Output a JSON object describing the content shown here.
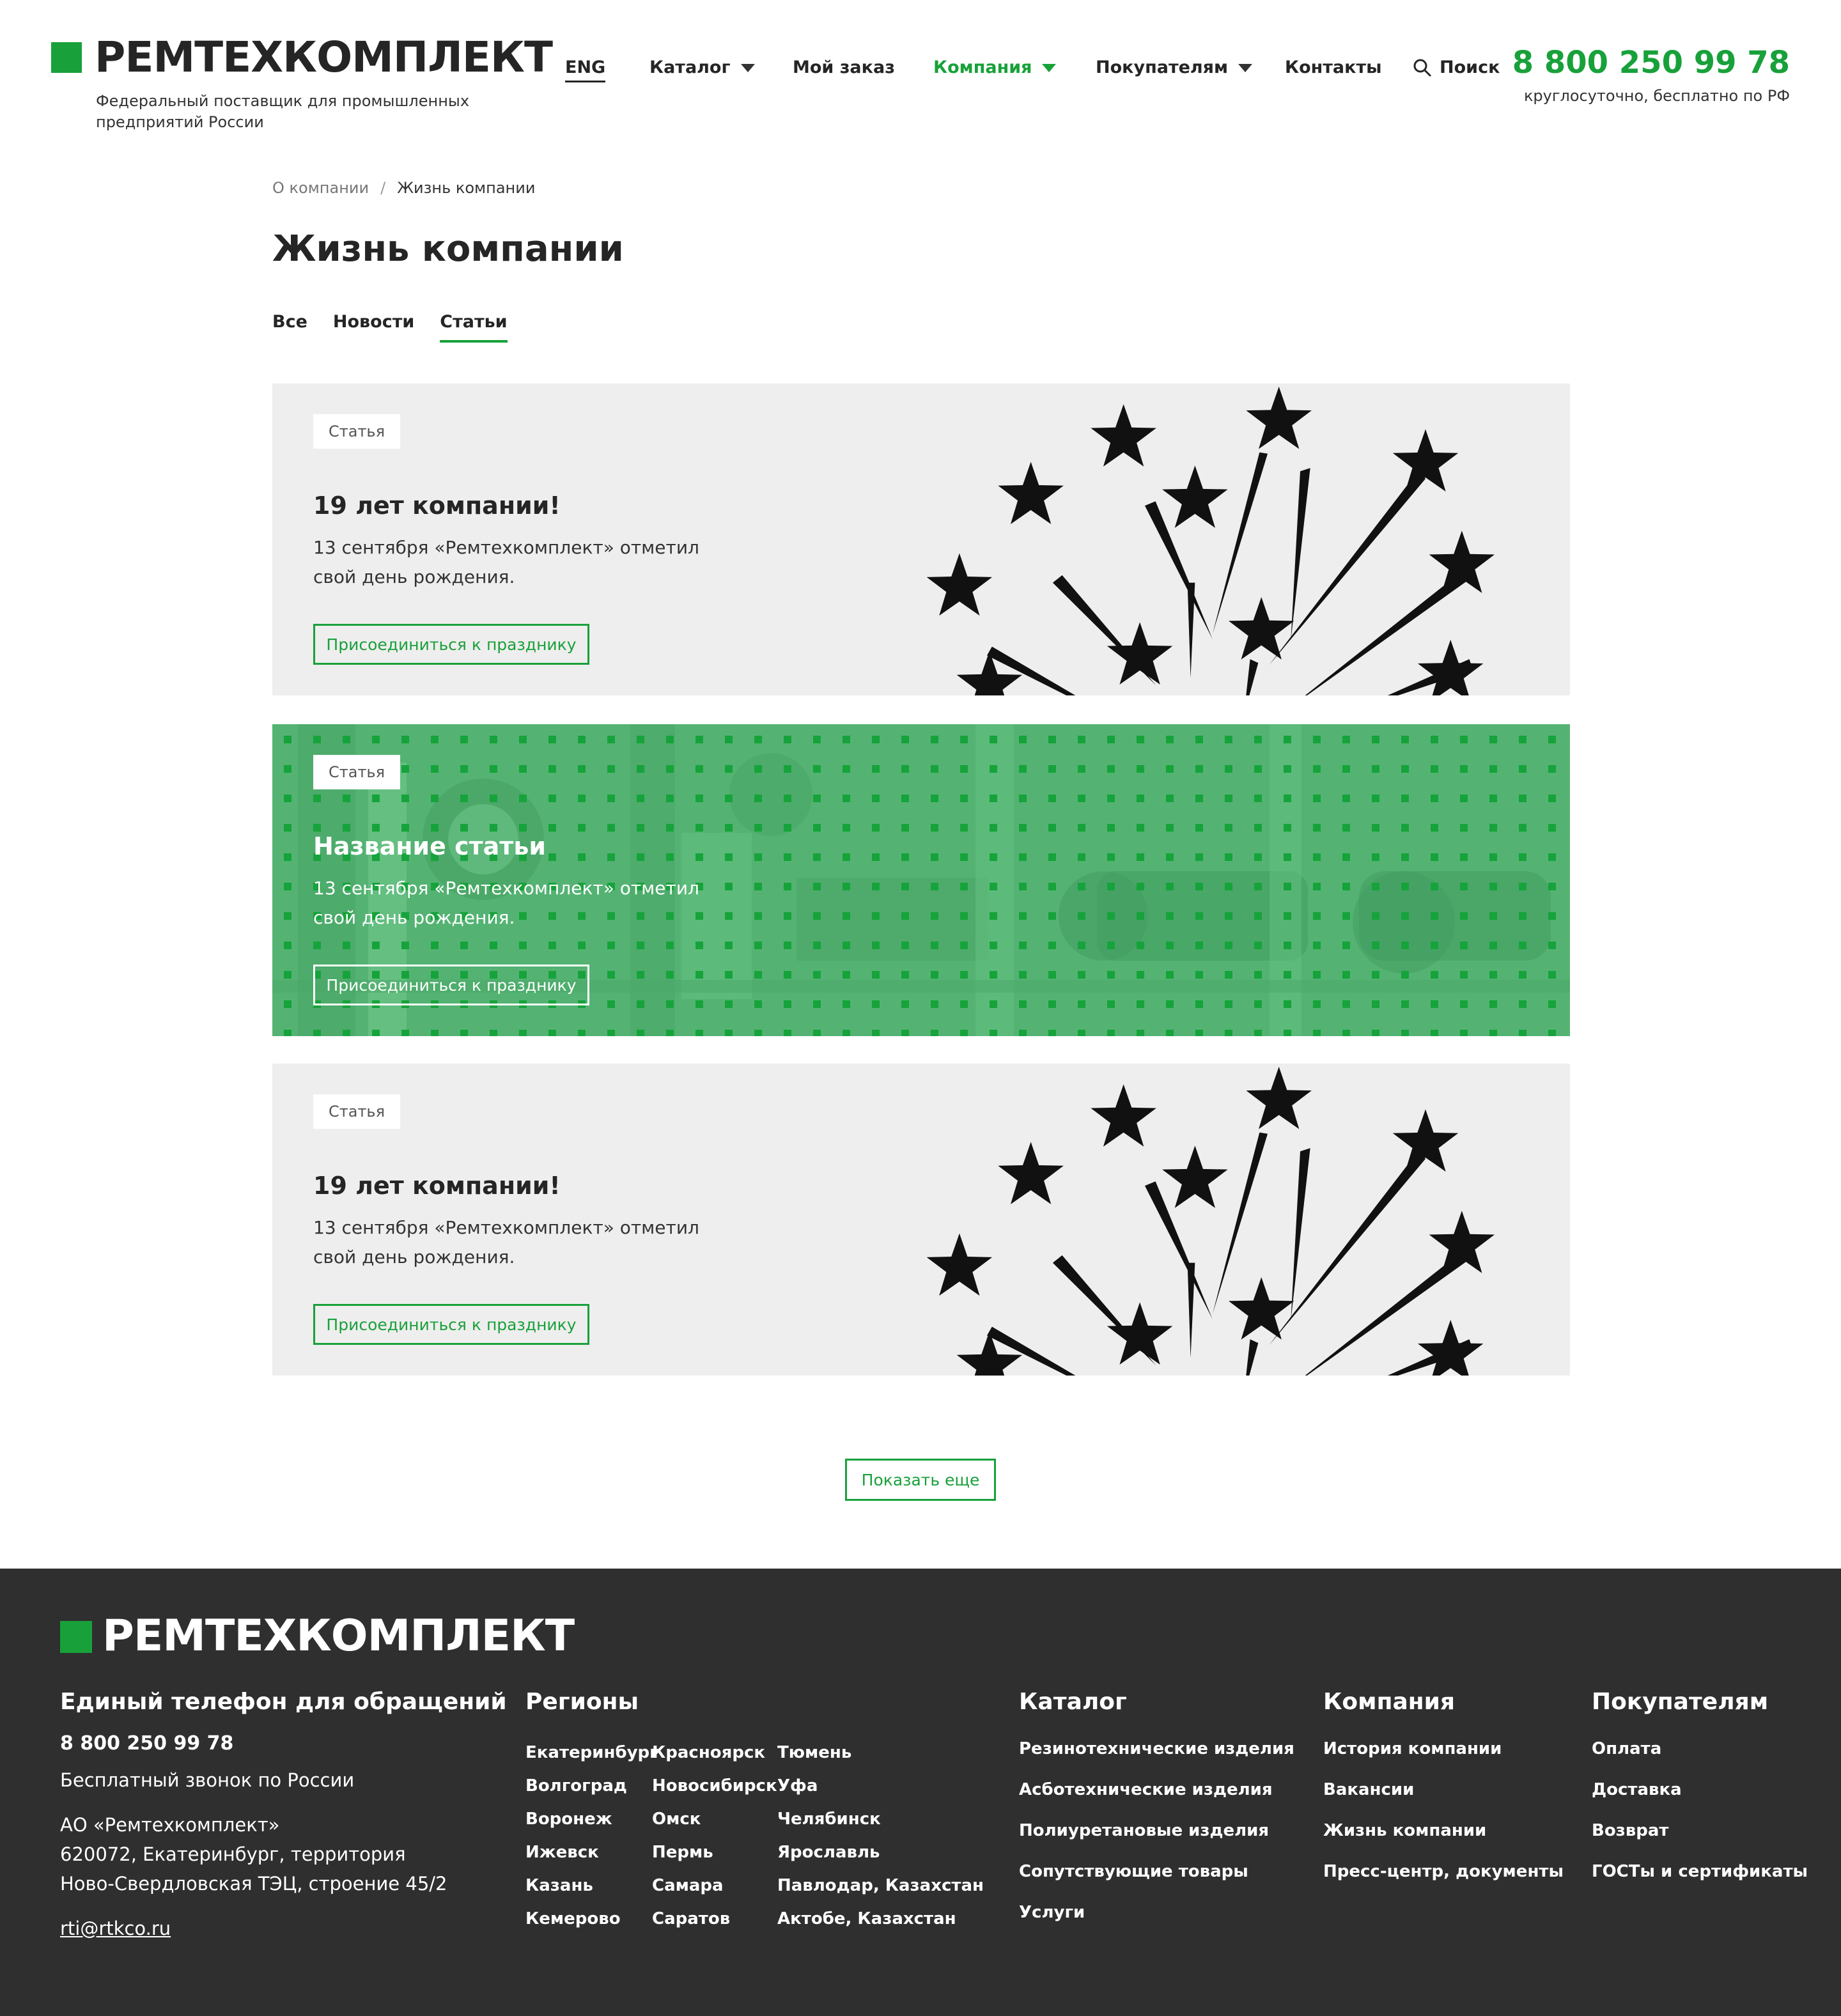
{
  "header": {
    "logo": "РЕМТЕХКОМПЛЕКТ",
    "tagline": "Федеральный поставщик для промышленных предприятий России",
    "nav": {
      "eng": "ENG",
      "catalog": "Каталог",
      "order": "Мой заказ",
      "company": "Компания",
      "buyers": "Покупателям",
      "contacts": "Контакты",
      "search": "Поиск"
    },
    "phone": "8 800 250 99 78",
    "phone_note": "круглосуточно, бесплатно по РФ"
  },
  "breadcrumb": {
    "parent": "О компании",
    "separator": "/",
    "current": "Жизнь компании"
  },
  "page_title": "Жизнь компании",
  "tabs": [
    "Все",
    "Новости",
    "Статьи"
  ],
  "cards": [
    {
      "badge": "Статья",
      "title": "19 лет компании!",
      "text": "13 сентября «Ремтехкомплект» отметил свой день рождения.",
      "button": "Присоединиться к празднику"
    },
    {
      "badge": "Статья",
      "title": "Название статьи",
      "text": "13 сентября «Ремтехкомплект» отметил свой день рождения.",
      "button": "Присоединиться к празднику"
    },
    {
      "badge": "Статья",
      "title": "19 лет компании!",
      "text": "13 сентября «Ремтехкомплект» отметил свой день рождения.",
      "button": "Присоединиться к празднику"
    }
  ],
  "show_more": "Показать еще",
  "footer": {
    "logo": "РЕМТЕХКОМПЛЕКТ",
    "contact_heading": "Единый телефон для обращений",
    "phone": "8 800 250 99 78",
    "phone_note": "Бесплатный звонок по России",
    "company_name": "АО «Ремтехкомплект»",
    "address_1": "620072, Екатеринбург, территория",
    "address_2": "Ново-Свердловская ТЭЦ, строение 45/2",
    "email": "rti@rtkco.ru",
    "regions_heading": "Регионы",
    "regions": [
      [
        "Екатеринбург",
        "Волгоград",
        "Воронеж",
        "Ижевск",
        "Казань",
        "Кемерово"
      ],
      [
        "Красноярск",
        "Новосибирск",
        "Омск",
        "Пермь",
        "Самара",
        "Саратов"
      ],
      [
        "Тюмень",
        "Уфа",
        "Челябинск",
        "Ярославль",
        "Павлодар, Казахстан",
        "Актобе, Казахстан"
      ]
    ],
    "catalog_heading": "Каталог",
    "catalog": [
      "Резинотехнические изделия",
      "Асботехнические изделия",
      "Полиуретановые изделия",
      "Сопутствующие товары",
      "Услуги"
    ],
    "company_heading": "Компания",
    "company": [
      "История компании",
      "Вакансии",
      "Жизнь компании",
      "Пресс-центр, документы"
    ],
    "buyers_heading": "Покупателям",
    "buyers": [
      "Оплата",
      "Доставка",
      "Возврат",
      "ГОСТы и сертификаты"
    ]
  },
  "colors": {
    "brand_green": "#18a13a",
    "card_gray": "#efeeee",
    "card_green": "#56b876",
    "footer_bg": "#2f2f2f"
  }
}
